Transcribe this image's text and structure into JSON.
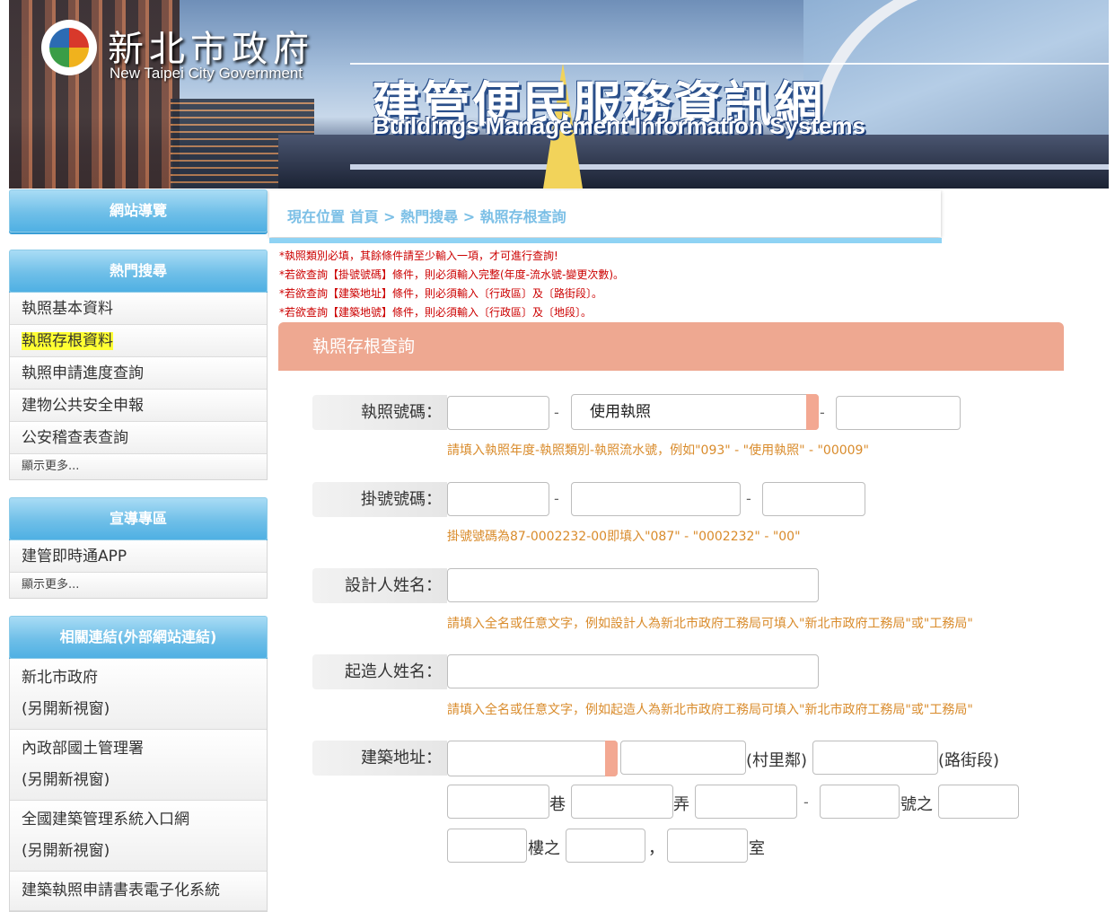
{
  "header": {
    "gov_name_zh": "新北市政府",
    "gov_name_en": "New Taipei City Government",
    "site_title_zh": "建管便民服務資訊網",
    "site_title_en": "Buildings Management Information Systems"
  },
  "sidebar": {
    "nav_title": "網站導覽",
    "hot_title": "熱門搜尋",
    "hot_items": [
      "執照基本資料",
      "執照存根資料",
      "執照申請進度查詢",
      "建物公共安全申報",
      "公安稽查表查詢"
    ],
    "hot_more": "顯示更多...",
    "promo_title": "宣導專區",
    "promo_items": [
      "建管即時通APP"
    ],
    "promo_more": "顯示更多...",
    "links_title": "相關連結(外部網站連結)",
    "links": [
      {
        "name": "新北市政府",
        "note": "(另開新視窗)"
      },
      {
        "name": "內政部國土管理署",
        "note": "(另開新視窗)"
      },
      {
        "name": "全國建築管理系統入口網",
        "note": "(另開新視窗)"
      },
      {
        "name": "建築執照申請書表電子化系統",
        "note": ""
      }
    ]
  },
  "breadcrumb": {
    "text": "現在位置 首頁 > 熱門搜尋 > 執照存根查詢"
  },
  "notes": [
    "*執照類別必填，其餘條件請至少輸入一項，才可進行查詢!",
    "*若欲查詢【掛號號碼】條件，則必須輸入完整(年度-流水號-變更次數)。",
    "*若欲查詢【建築地址】條件，則必須輸入〔行政區〕及〔路街段〕。",
    "*若欲查詢【建築地號】條件，則必須輸入〔行政區〕及〔地段〕。"
  ],
  "panel": {
    "title": "執照存根查詢"
  },
  "form": {
    "license_label": "執照號碼：",
    "license_year": "",
    "license_type_selected": "使用執照",
    "license_serial": "",
    "license_hint": "請填入執照年度-執照類別-執照流水號，例如\"093\" - \"使用執照\" - \"00009\"",
    "reg_label": "掛號號碼：",
    "reg_hint": "掛號號碼為87-0002232-00即填入\"087\" - \"0002232\" - \"00\"",
    "designer_label": "設計人姓名：",
    "designer_hint": "請填入全名或任意文字，例如設計人為新北市政府工務局可填入\"新北市政府工務局\"或\"工務局\"",
    "builder_label": "起造人姓名：",
    "builder_hint": "請填入全名或任意文字，例如起造人為新北市政府工務局可填入\"新北市政府工務局\"或\"工務局\"",
    "address_label": "建築地址：",
    "unit_village": "(村里鄰)",
    "unit_road": "(路街段)",
    "unit_lane": "巷",
    "unit_alley": "弄",
    "unit_dash": "-",
    "unit_number": "號之",
    "unit_floor": "樓之",
    "unit_comma": "，",
    "unit_room": "室",
    "separator": "-"
  }
}
